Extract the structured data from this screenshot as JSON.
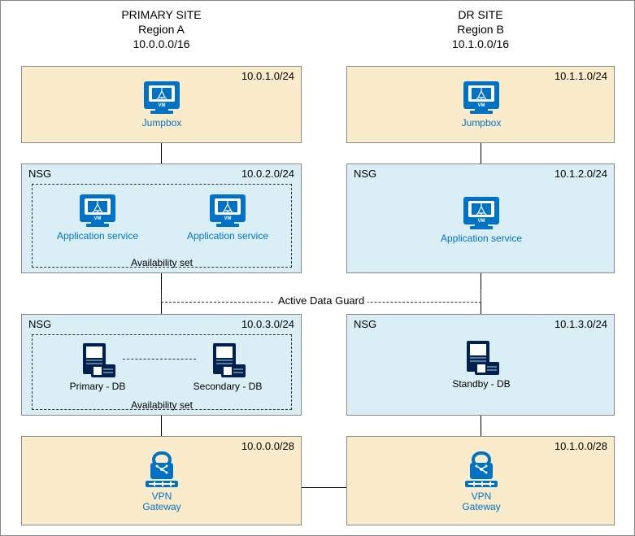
{
  "primary": {
    "title": "PRIMARY SITE",
    "region": "Region A",
    "cidr": "10.0.0.0/16",
    "jumpbox": {
      "cidr": "10.0.1.0/24",
      "label": "Jumpbox"
    },
    "app": {
      "cidr": "10.0.2.0/24",
      "nsg": "NSG",
      "avset": "Availability set",
      "vm1": "Application service",
      "vm2": "Application service"
    },
    "db": {
      "cidr": "10.0.3.0/24",
      "nsg": "NSG",
      "avset": "Availability set",
      "db1": "Primary - DB",
      "db2": "Secondary - DB"
    },
    "vpn": {
      "cidr": "10.0.0.0/28",
      "label1": "VPN",
      "label2": "Gateway"
    }
  },
  "dr": {
    "title": "DR SITE",
    "region": "Region B",
    "cidr": "10.1.0.0/16",
    "jumpbox": {
      "cidr": "10.1.1.0/24",
      "label": "Jumpbox"
    },
    "app": {
      "cidr": "10.1.2.0/24",
      "nsg": "NSG",
      "label": "Application service"
    },
    "db": {
      "cidr": "10.1.3.0/24",
      "nsg": "NSG",
      "label": "Standby - DB"
    },
    "vpn": {
      "cidr": "10.1.0.0/28",
      "label1": "VPN",
      "label2": "Gateway"
    }
  },
  "link_label": "Active Data Guard"
}
